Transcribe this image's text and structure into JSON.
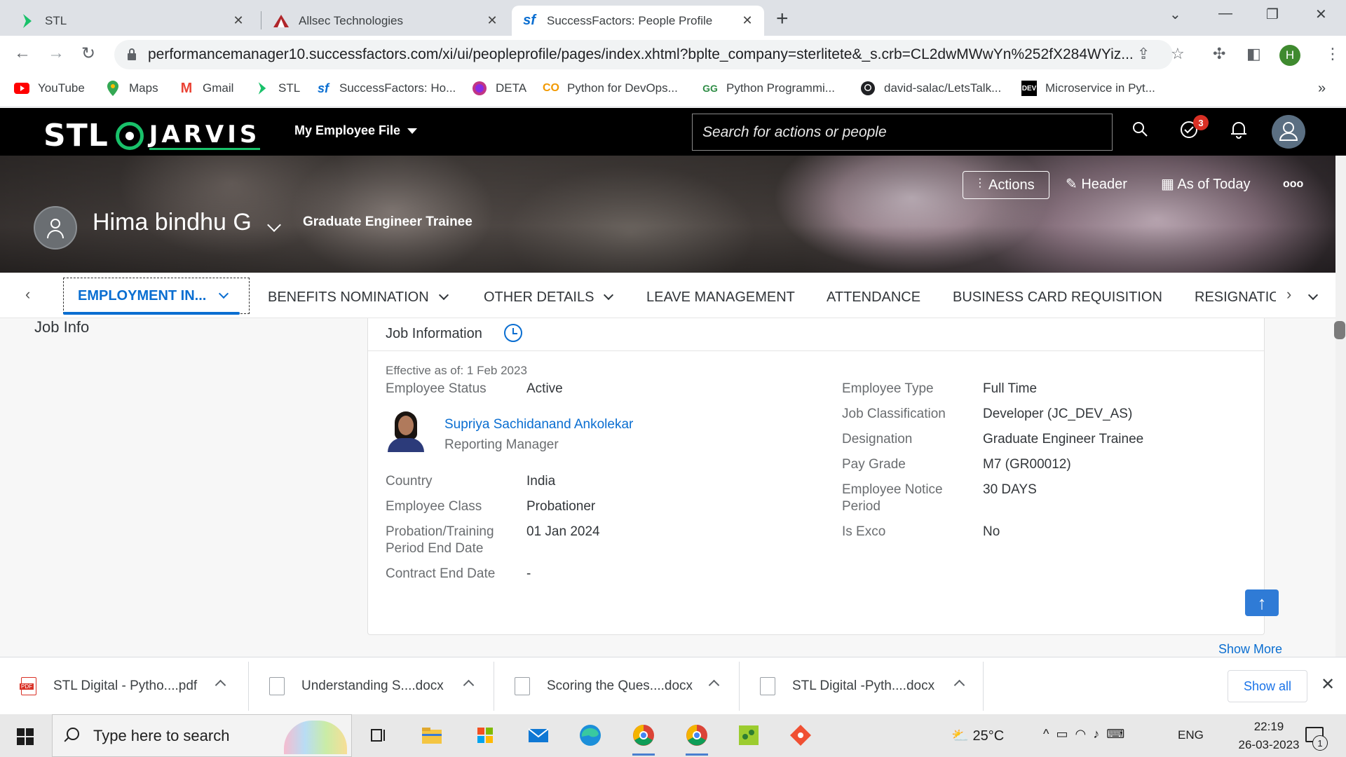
{
  "browser": {
    "tabs": [
      {
        "title": "STL",
        "favicon": "stl-chevron-icon",
        "active": false
      },
      {
        "title": "Allsec Technologies",
        "favicon": "allsec-logo-icon",
        "active": false
      },
      {
        "title": "SuccessFactors: People Profile",
        "favicon": "sf-logo-icon",
        "active": true
      }
    ],
    "new_tab": "+",
    "url": "performancemanager10.successfactors.com/xi/ui/peopleprofile/pages/index.xhtml?bplte_company=sterlitete&_s.crb=CL2dwMWwYn%252fX284WYiz...",
    "profile_initial": "H",
    "bookmarks": [
      {
        "label": "YouTube",
        "icon": "youtube-icon",
        "color": "#ff0000"
      },
      {
        "label": "Maps",
        "icon": "maps-icon",
        "color": "#34a853"
      },
      {
        "label": "Gmail",
        "icon": "gmail-icon",
        "color": "#ea4335"
      },
      {
        "label": "STL",
        "icon": "stl-icon",
        "color": "#19c16a"
      },
      {
        "label": "SuccessFactors: Ho...",
        "icon": "sf-icon",
        "color": "#0a6ed1"
      },
      {
        "label": "DETA",
        "icon": "deta-icon",
        "color": "#c13584"
      },
      {
        "label": "Python for DevOps...",
        "icon": "co-icon",
        "color": "#f29900"
      },
      {
        "label": "Python Programmi...",
        "icon": "gfg-icon",
        "color": "#2f8d46"
      },
      {
        "label": "david-salac/LetsTalk...",
        "icon": "github-icon",
        "color": "#202124"
      },
      {
        "label": "Microservice in Pyt...",
        "icon": "dev-icon",
        "color": "#000000"
      }
    ],
    "bookmarks_more": "»"
  },
  "sf_header": {
    "logo_left": "STL",
    "logo_right": "JARVIS",
    "menu_label": "My Employee File",
    "search_placeholder": "Search for actions or people",
    "todo_badge": "3",
    "colors": {
      "brand_green": "#19c16a",
      "accent_blue": "#0a6ed1"
    }
  },
  "banner": {
    "actions_label": "Actions",
    "header_label": "Header",
    "as_of_label": "As of Today",
    "more": "ooo",
    "employee_name": "Hima bindhu G",
    "employee_title": "Graduate Engineer Trainee"
  },
  "section_tabs": {
    "active": "EMPLOYMENT IN...",
    "others": [
      "BENEFITS NOMINATION",
      "OTHER DETAILS",
      "LEAVE MANAGEMENT",
      "ATTENDANCE",
      "BUSINESS CARD REQUISITION",
      "RESIGNATIO"
    ]
  },
  "content": {
    "left_title": "Job Info",
    "card_title": "Job Information",
    "effective": "Effective as of: 1 Feb 2023",
    "left_fields": [
      {
        "label": "Employee Status",
        "value": "Active"
      },
      {
        "label": "Country",
        "value": "India"
      },
      {
        "label": "Employee Class",
        "value": "Probationer"
      },
      {
        "label": "Probation/Training Period End Date",
        "value": "01 Jan 2024"
      },
      {
        "label": "Contract End Date",
        "value": "-"
      }
    ],
    "manager": {
      "name": "Supriya Sachidanand Ankolekar",
      "role": "Reporting Manager"
    },
    "right_fields": [
      {
        "label": "Employee Type",
        "value": "Full Time"
      },
      {
        "label": "Job Classification",
        "value": "Developer (JC_DEV_AS)"
      },
      {
        "label": "Designation",
        "value": "Graduate Engineer Trainee"
      },
      {
        "label": "Pay Grade",
        "value": "M7 (GR00012)"
      },
      {
        "label": "Employee Notice Period",
        "value": "30 DAYS"
      },
      {
        "label": "Is Exco",
        "value": "No"
      }
    ],
    "show_more": "Show More"
  },
  "downloads": {
    "items": [
      {
        "name": "STL Digital - Pytho....pdf",
        "type": "pdf"
      },
      {
        "name": "Understanding S....docx",
        "type": "docx"
      },
      {
        "name": "Scoring the Ques....docx",
        "type": "docx"
      },
      {
        "name": "STL Digital -Pyth....docx",
        "type": "docx"
      }
    ],
    "show_all": "Show all"
  },
  "taskbar": {
    "search_placeholder": "Type here to search",
    "weather": "25°C",
    "language": "ENG",
    "time": "22:19",
    "date": "26-03-2023",
    "notification_count": "1"
  }
}
